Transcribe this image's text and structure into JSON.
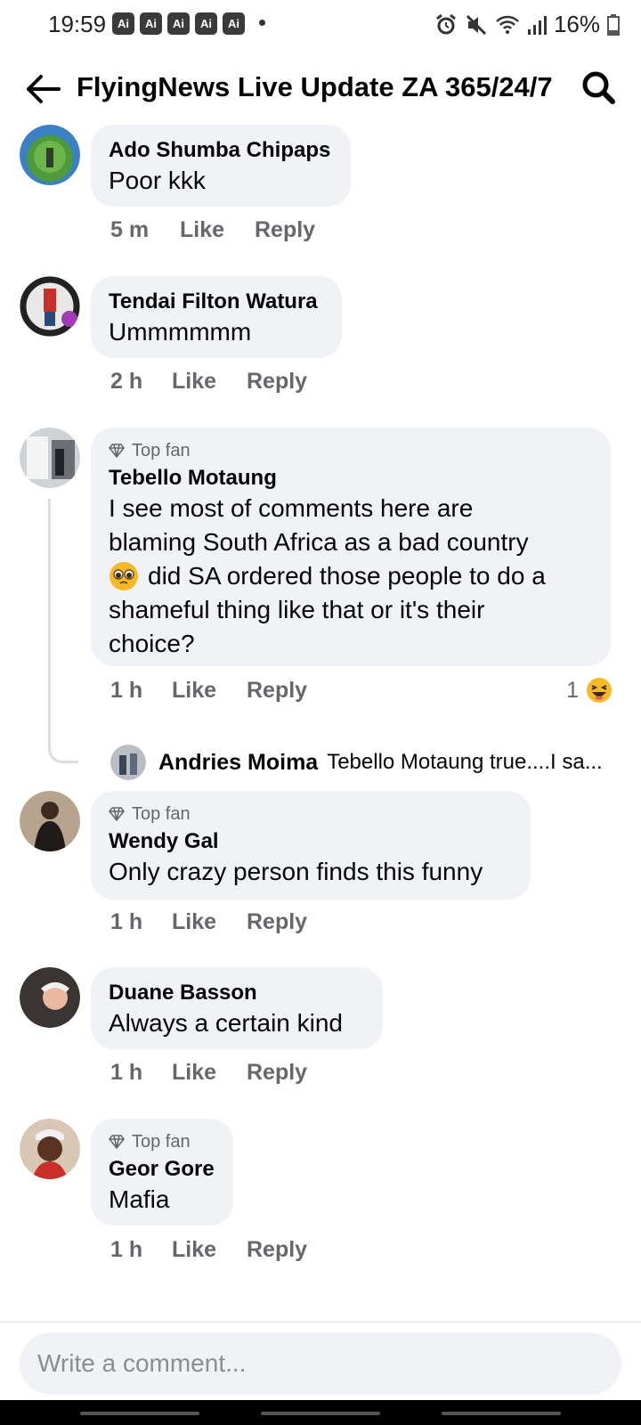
{
  "status_bar": {
    "time": "19:59",
    "ai_badges": [
      "Ai",
      "Ai",
      "Ai",
      "Ai",
      "Ai"
    ],
    "battery": "16%"
  },
  "header": {
    "title": "FlyingNews Live Update ZA 365/24/7"
  },
  "comments": [
    {
      "author": "Ado Shumba Chipaps",
      "text": "Poor kkk",
      "time": "5 m",
      "like": "Like",
      "reply": "Reply"
    },
    {
      "author": "Tendai Filton Watura",
      "text": "Ummmmmm",
      "time": "2 h",
      "like": "Like",
      "reply": "Reply"
    },
    {
      "top_fan": "Top fan",
      "author": "Tebello Motaung",
      "text_lines": [
        "I see most of comments here are",
        "blaming South Africa as a bad country",
        "did SA ordered those people to do a",
        "shameful thing like that or it's their",
        "choice?"
      ],
      "time": "1 h",
      "like": "Like",
      "reply": "Reply",
      "reaction_count": "1"
    },
    {
      "top_fan": "Top fan",
      "author": "Wendy Gal",
      "text": "Only crazy person finds this funny",
      "time": "1 h",
      "like": "Like",
      "reply": "Reply"
    },
    {
      "author": "Duane Basson",
      "text": "Always a certain kind",
      "time": "1 h",
      "like": "Like",
      "reply": "Reply"
    },
    {
      "top_fan": "Top fan",
      "author": "Geor Gore",
      "text": "Mafia",
      "time": "1 h",
      "like": "Like",
      "reply": "Reply"
    }
  ],
  "reply_preview": {
    "author": "Andries Moima",
    "text": "Tebello Motaung true....I sa..."
  },
  "composer": {
    "placeholder": "Write a comment..."
  },
  "colors": {
    "bubble": "#f0f2f5",
    "secondary_text": "#65676b",
    "haha_emoji": "#f7b928"
  }
}
